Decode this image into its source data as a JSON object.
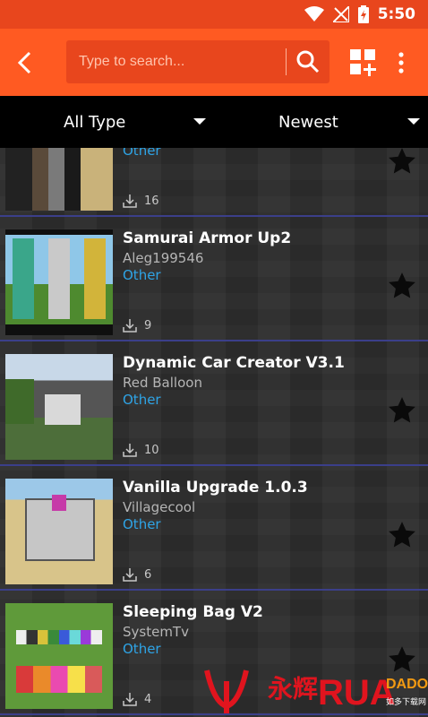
{
  "status_bar": {
    "time": "5:50"
  },
  "search": {
    "placeholder": "Type to search..."
  },
  "filters": {
    "type": "All Type",
    "sort": "Newest"
  },
  "items": [
    {
      "title": "",
      "author": "",
      "category": "Other",
      "downloads": "16"
    },
    {
      "title": "Samurai Armor Up2",
      "author": "Aleg199546",
      "category": "Other",
      "downloads": "9"
    },
    {
      "title": "Dynamic Car Creator V3.1",
      "author": "Red Balloon",
      "category": "Other",
      "downloads": "10"
    },
    {
      "title": "Vanilla Upgrade 1.0.3",
      "author": "Villagecool",
      "category": "Other",
      "downloads": "6"
    },
    {
      "title": "Sleeping Bag V2",
      "author": "SystemTv",
      "category": "Other",
      "downloads": "4"
    }
  ],
  "watermark": {
    "text_cn": "永辉",
    "text_brand": "RUA",
    "text_brand2": "DADO",
    "text_sub": "如多下载网"
  },
  "colors": {
    "appbar": "#ff5a22",
    "statusbar": "#e8461d",
    "category": "#2ea4e6",
    "divider": "#3b3f8a"
  },
  "icons": [
    "wifi-icon",
    "signal-icon",
    "battery-icon",
    "back-icon",
    "search-icon",
    "add-grid-icon",
    "more-icon",
    "download-icon",
    "star-icon"
  ]
}
